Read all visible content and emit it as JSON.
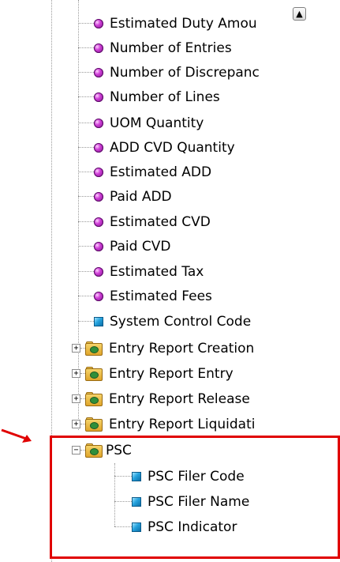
{
  "tree": {
    "measures": [
      {
        "label": "Estimated Duty Amou",
        "icon": "measure-sphere-icon"
      },
      {
        "label": "Number of Entries",
        "icon": "measure-sphere-icon"
      },
      {
        "label": "Number of Discrepanc",
        "icon": "measure-sphere-icon"
      },
      {
        "label": "Number of Lines",
        "icon": "measure-sphere-icon"
      },
      {
        "label": "UOM Quantity",
        "icon": "measure-sphere-icon"
      },
      {
        "label": "ADD CVD Quantity",
        "icon": "measure-sphere-icon"
      },
      {
        "label": "Estimated ADD",
        "icon": "measure-sphere-icon"
      },
      {
        "label": "Paid ADD",
        "icon": "measure-sphere-icon"
      },
      {
        "label": "Estimated CVD",
        "icon": "measure-sphere-icon"
      },
      {
        "label": "Paid CVD",
        "icon": "measure-sphere-icon"
      },
      {
        "label": "Estimated Tax",
        "icon": "measure-sphere-icon"
      },
      {
        "label": "Estimated Fees",
        "icon": "measure-sphere-icon"
      }
    ],
    "dimension": {
      "label": "System Control Code",
      "icon": "dimension-cube-icon"
    },
    "folders": [
      {
        "label": "Entry Report Creation",
        "expander": "+"
      },
      {
        "label": "Entry Report Entry",
        "expander": "+"
      },
      {
        "label": "Entry Report Release",
        "expander": "+"
      },
      {
        "label": "Entry Report Liquidati",
        "expander": "+"
      }
    ],
    "psc": {
      "label": "PSC",
      "expander": "−",
      "children": [
        {
          "label": "PSC Filer Code",
          "icon": "dimension-cube-icon"
        },
        {
          "label": "PSC Filer Name",
          "icon": "dimension-cube-icon"
        },
        {
          "label": "PSC Indicator",
          "icon": "dimension-cube-icon"
        }
      ]
    }
  },
  "scrollbar": {
    "up_arrow": "▲"
  },
  "colors": {
    "highlight": "#e00000",
    "arrow": "#e00000"
  }
}
